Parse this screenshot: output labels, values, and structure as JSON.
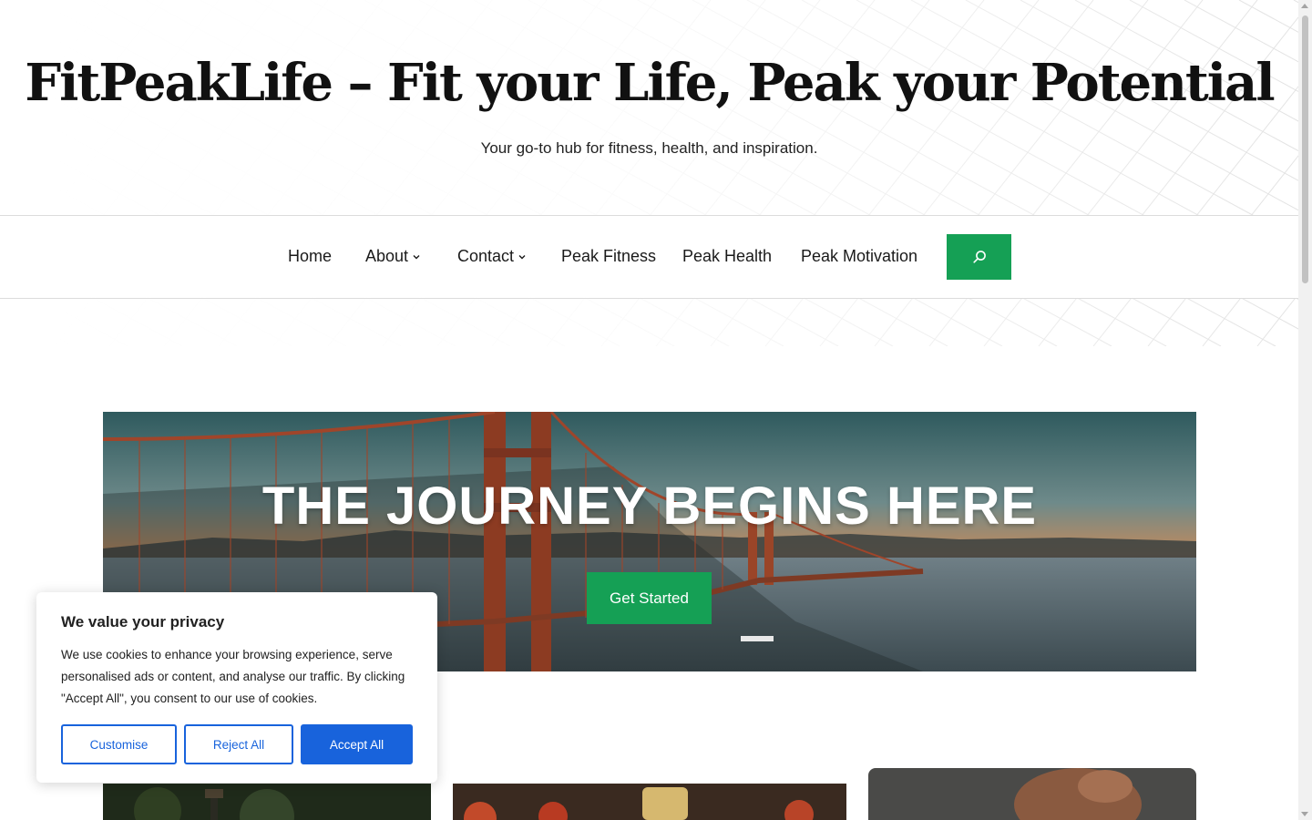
{
  "site": {
    "title": "FitPeakLife – Fit your Life, Peak your Potential",
    "tagline": "Your go-to hub for fitness, health, and inspiration."
  },
  "nav": {
    "items": [
      {
        "label": "Home",
        "has_dropdown": false
      },
      {
        "label": "About",
        "has_dropdown": true
      },
      {
        "label": "Contact",
        "has_dropdown": true
      },
      {
        "label": "Peak Fitness",
        "has_dropdown": false
      },
      {
        "label": "Peak Health",
        "has_dropdown": false
      },
      {
        "label": "Peak Motivation",
        "has_dropdown": false
      }
    ],
    "search_icon": "search-icon"
  },
  "hero": {
    "title": "THE JOURNEY BEGINS HERE",
    "cta_label": "Get Started",
    "image": "golden-gate-bridge-sunset"
  },
  "cards": [
    {
      "image": "park-lamp-trees"
    },
    {
      "image": "healthy-food-table"
    },
    {
      "image": "fist-hand"
    }
  ],
  "cookie_banner": {
    "title": "We value your privacy",
    "text": "We use cookies to enhance your browsing experience, serve personalised ads or content, and analyse our traffic. By clicking \"Accept All\", you consent to our use of cookies.",
    "customise_label": "Customise",
    "reject_label": "Reject All",
    "accept_label": "Accept All"
  },
  "colors": {
    "accent_green": "#15a055",
    "cookie_blue": "#1863dc",
    "text_dark": "#111111"
  }
}
